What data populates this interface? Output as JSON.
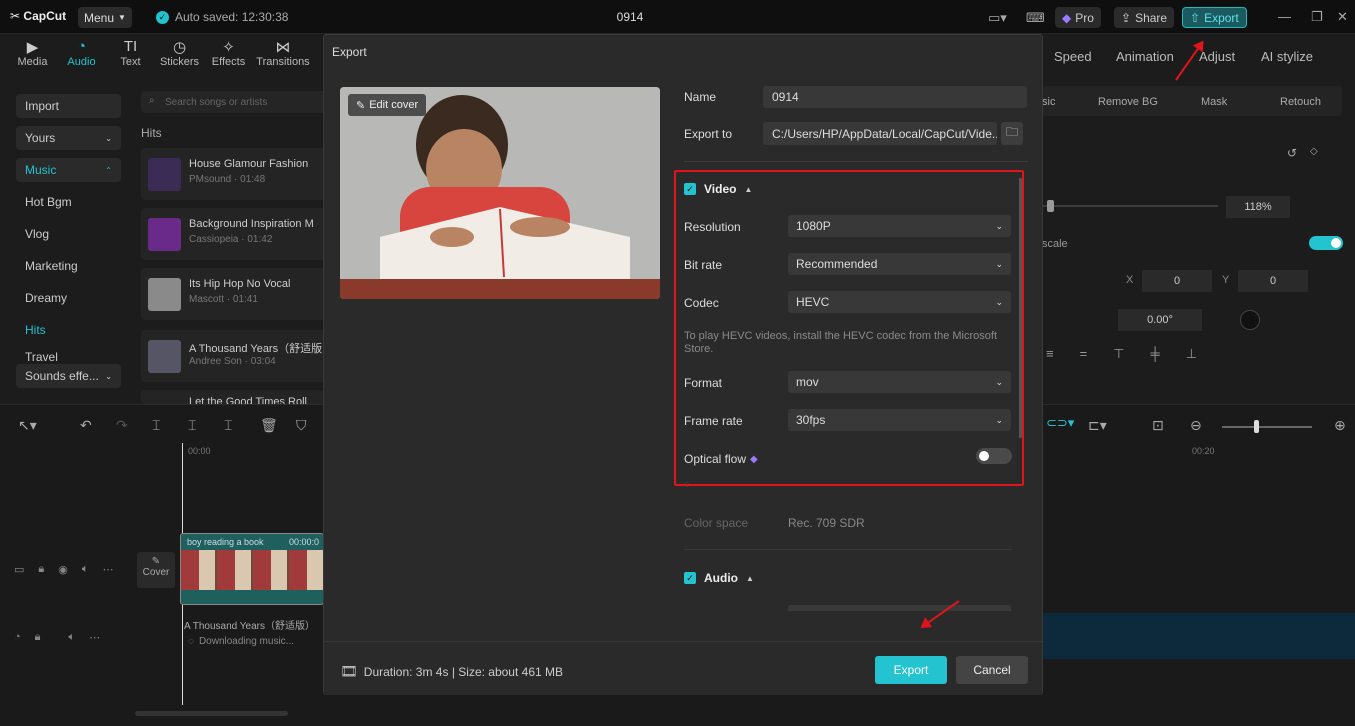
{
  "topbar": {
    "logo": "CapCut",
    "menu": "Menu",
    "autosaved": "Auto saved: 12:30:38",
    "project_title": "0914",
    "pro": "Pro",
    "share": "Share",
    "export": "Export"
  },
  "tools": [
    {
      "label": "Media",
      "icon": "media-icon"
    },
    {
      "label": "Audio",
      "icon": "audio-icon"
    },
    {
      "label": "Text",
      "icon": "text-icon"
    },
    {
      "label": "Stickers",
      "icon": "stickers-icon"
    },
    {
      "label": "Effects",
      "icon": "effects-icon"
    },
    {
      "label": "Transitions",
      "icon": "transitions-icon"
    }
  ],
  "categories": {
    "import": "Import",
    "yours": "Yours",
    "music": "Music",
    "hot": "Hot Bgm",
    "vlog": "Vlog",
    "marketing": "Marketing",
    "dreamy": "Dreamy",
    "hits": "Hits",
    "travel": "Travel",
    "sounds": "Sounds effe..."
  },
  "search_placeholder": "Search songs or artists",
  "hits_heading": "Hits",
  "tracks": [
    {
      "title": "House Glamour Fashion",
      "sub": "PMsound · 01:48"
    },
    {
      "title": "Background Inspiration M",
      "sub": "Cassiopeia · 01:42"
    },
    {
      "title": "Its Hip Hop No Vocal",
      "sub": "Mascott · 01:41"
    },
    {
      "title": "A Thousand Years（舒适版",
      "sub": "Andree Son · 03:04"
    },
    {
      "title": "Let the Good Times Roll",
      "sub": ""
    }
  ],
  "right": {
    "speed": "Speed",
    "animation": "Animation",
    "adjust": "Adjust",
    "ai": "AI stylize",
    "basic": "sic",
    "removebg": "Remove BG",
    "mask": "Mask",
    "retouch": "Retouch",
    "scale_pct": "118%",
    "scale_lbl": "scale",
    "x_lbl": "X",
    "x_val": "0",
    "y_lbl": "Y",
    "y_val": "0",
    "rot": "0.00°"
  },
  "timeline": {
    "t0": "00:00",
    "t20": "00:20",
    "clip_label": "boy reading  a book",
    "clip_time": "00:00:0",
    "cover": "Cover",
    "audio_title": "A Thousand Years（舒适版）",
    "downloading": "Downloading music..."
  },
  "dialog": {
    "title": "Export",
    "edit_cover": "Edit cover",
    "name_label": "Name",
    "name_value": "0914",
    "export_to_label": "Export to",
    "export_to_value": "C:/Users/HP/AppData/Local/CapCut/Vide...",
    "video_label": "Video",
    "resolution_label": "Resolution",
    "resolution_value": "1080P",
    "bitrate_label": "Bit rate",
    "bitrate_value": "Recommended",
    "codec_label": "Codec",
    "codec_value": "HEVC",
    "codec_note": "To play HEVC videos, install the HEVC codec from the Microsoft Store.",
    "format_label": "Format",
    "format_value": "mov",
    "framerate_label": "Frame rate",
    "framerate_value": "30fps",
    "optical_label": "Optical flow",
    "colorspace_label": "Color space",
    "colorspace_value": "Rec. 709 SDR",
    "audio_label": "Audio",
    "footer_info": "Duration: 3m 4s | Size: about 461 MB",
    "export_btn": "Export",
    "cancel_btn": "Cancel"
  },
  "colors": {
    "accent": "#23c3cf",
    "highlight": "#e0141b"
  }
}
